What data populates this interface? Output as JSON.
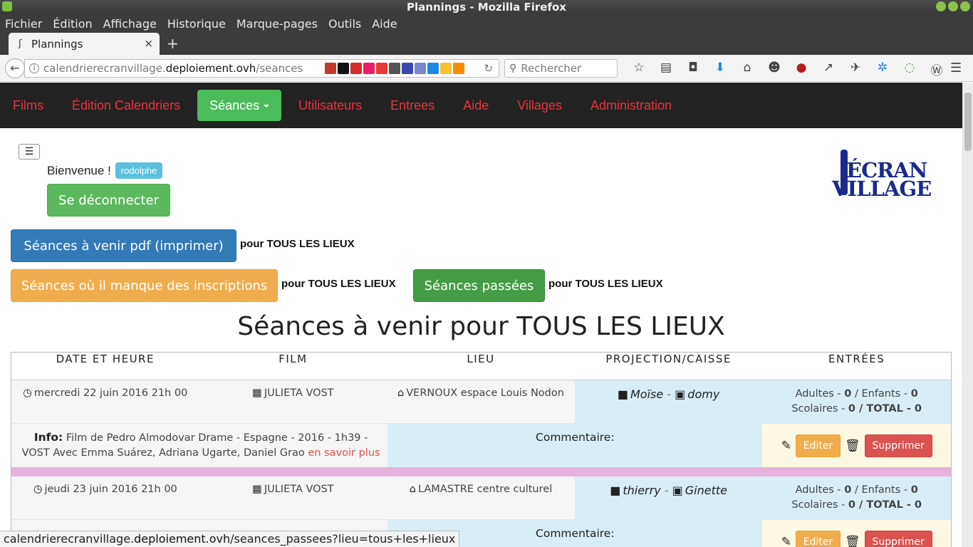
{
  "window": {
    "title": "Plannings - Mozilla Firefox"
  },
  "menubar": {
    "items": [
      "Fichier",
      "Édition",
      "Affichage",
      "Historique",
      "Marque-pages",
      "Outils",
      "Aide"
    ]
  },
  "tab": {
    "title": "Plannings",
    "close": "×",
    "new": "+"
  },
  "navbar": {
    "url_prefix": "calendrierecranvillage.",
    "url_host": "deploiement.ovh",
    "url_path": "/seances",
    "search_placeholder": "Rechercher"
  },
  "app_nav": {
    "items": [
      "Films",
      "Édition Calendriers",
      "Séances",
      "Utilisateurs",
      "Entrees",
      "Aide",
      "Villages",
      "Administration"
    ],
    "active": "Séances"
  },
  "welcome": {
    "text": "Bienvenue !",
    "user": "rodolphe"
  },
  "buttons": {
    "logout": "Se déconnecter",
    "pdf": "Séances à venir pdf (imprimer)",
    "missing": "Séances où il manque des inscriptions",
    "past": "Séances passées",
    "for_all": "pour TOUS LES LIEUX"
  },
  "logo": {
    "line1": "ÉCRAN",
    "line2": "VILLAGE"
  },
  "page_title": "Séances à venir pour TOUS LES LIEUX",
  "table": {
    "headers": [
      "DATE ET HEURE",
      "FILM",
      "LIEU",
      "PROJECTION/CAISSE",
      "ENTRÉES"
    ],
    "rows": [
      {
        "date": "mercredi 22 juin 2016 21h 00",
        "film": "JULIETA VOST",
        "lieu": "VERNOUX espace Louis Nodon",
        "projection": "Moïse",
        "caisse": "domy",
        "entrees_line1_a": "Adultes - ",
        "entrees_adultes": "0",
        "entrees_line1_b": " / Enfants - ",
        "entrees_enfants": "0",
        "entrees_line2_a": "Scolaires - ",
        "entrees_scolaires": "0",
        "entrees_line2_b": " / TOTAL - ",
        "entrees_total": "0",
        "info_label": "Info:",
        "info_text": "Film de Pedro Almodovar Drame - Espagne - 2016 - 1h39 - VOST Avec Emma Suárez, Adriana Ugarte, Daniel Grao",
        "info_link": "en savoir plus",
        "comment_label": "Commentaire:",
        "edit": "Editer",
        "delete": "Supprimer"
      },
      {
        "date": "jeudi 23 juin 2016 21h 00",
        "film": "JULIETA VOST",
        "lieu": "LAMASTRE centre culturel",
        "projection": "thierry",
        "caisse": "Ginette",
        "entrees_line1_a": "Adultes - ",
        "entrees_adultes": "0",
        "entrees_line1_b": " / Enfants - ",
        "entrees_enfants": "0",
        "entrees_line2_a": "Scolaires - ",
        "entrees_scolaires": "0",
        "entrees_line2_b": " / TOTAL - ",
        "entrees_total": "0",
        "comment_label": "Commentaire:",
        "edit": "Editer",
        "delete": "Supprimer"
      }
    ]
  },
  "statusbar": {
    "prefix": "calendrierecranvillage.",
    "host": "deploiement.ovh",
    "path": "/seances_passees?lieu=tous+les+lieux"
  },
  "colors": {
    "nav_link": "#e8363f",
    "nav_active_bg": "#4cbb5a",
    "divider": "#e6b3dc",
    "projection_bg": "#d9edf7"
  }
}
